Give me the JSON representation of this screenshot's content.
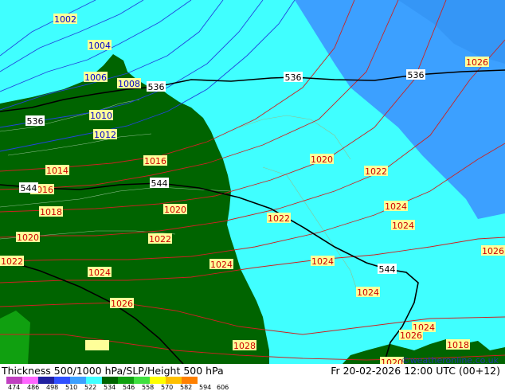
{
  "title": "Thickness 500/1000 hPa/SLP/Height 500 hPa",
  "datetime": "Fr 20-02-2026 12:00 UTC (00+12)",
  "credit": "©weatheronline.co.uk",
  "legend": {
    "ticks": [
      "474",
      "486",
      "498",
      "510",
      "522",
      "534",
      "546",
      "558",
      "570",
      "582",
      "594",
      "606"
    ],
    "colors": [
      "#c040c0",
      "#ff66ff",
      "#2020a0",
      "#3050ff",
      "#3ca0ff",
      "#40ffff",
      "#006400",
      "#10a010",
      "#40e040",
      "#ffff00",
      "#ffc000",
      "#ff8000"
    ]
  },
  "colors": {
    "thickness_534_546": "#40ffff",
    "thickness_522_534": "#3ca0ff",
    "land": "#006400",
    "isobar_high": "#cc2222",
    "isobar_low": "#2244dd",
    "height_500": "#000000"
  },
  "isobar_labels": [
    {
      "text": "1002",
      "kind": "low"
    },
    {
      "text": "1004",
      "kind": "low"
    },
    {
      "text": "1006",
      "kind": "low"
    },
    {
      "text": "1008",
      "kind": "low"
    },
    {
      "text": "1010",
      "kind": "low"
    },
    {
      "text": "1012",
      "kind": "low"
    },
    {
      "text": "1014",
      "kind": "high"
    },
    {
      "text": "1016",
      "kind": "high"
    },
    {
      "text": "1016",
      "kind": "high"
    },
    {
      "text": "1018",
      "kind": "high"
    },
    {
      "text": "1018",
      "kind": "high"
    },
    {
      "text": "1020",
      "kind": "high"
    },
    {
      "text": "1020",
      "kind": "high"
    },
    {
      "text": "1020",
      "kind": "high"
    },
    {
      "text": "1020",
      "kind": "high"
    },
    {
      "text": "1022",
      "kind": "high"
    },
    {
      "text": "1022",
      "kind": "high"
    },
    {
      "text": "1022",
      "kind": "high"
    },
    {
      "text": "1022",
      "kind": "high"
    },
    {
      "text": "1024",
      "kind": "high"
    },
    {
      "text": "1024",
      "kind": "high"
    },
    {
      "text": "1024",
      "kind": "high"
    },
    {
      "text": "1024",
      "kind": "high"
    },
    {
      "text": "1024",
      "kind": "high"
    },
    {
      "text": "1024",
      "kind": "high"
    },
    {
      "text": "1024",
      "kind": "high"
    },
    {
      "text": "1026",
      "kind": "high"
    },
    {
      "text": "1026",
      "kind": "high"
    },
    {
      "text": "1026",
      "kind": "high"
    },
    {
      "text": "1026",
      "kind": "high"
    },
    {
      "text": "1028",
      "kind": "high"
    }
  ],
  "height_labels": [
    "536",
    "536",
    "536",
    "536",
    "544",
    "544",
    "544"
  ]
}
